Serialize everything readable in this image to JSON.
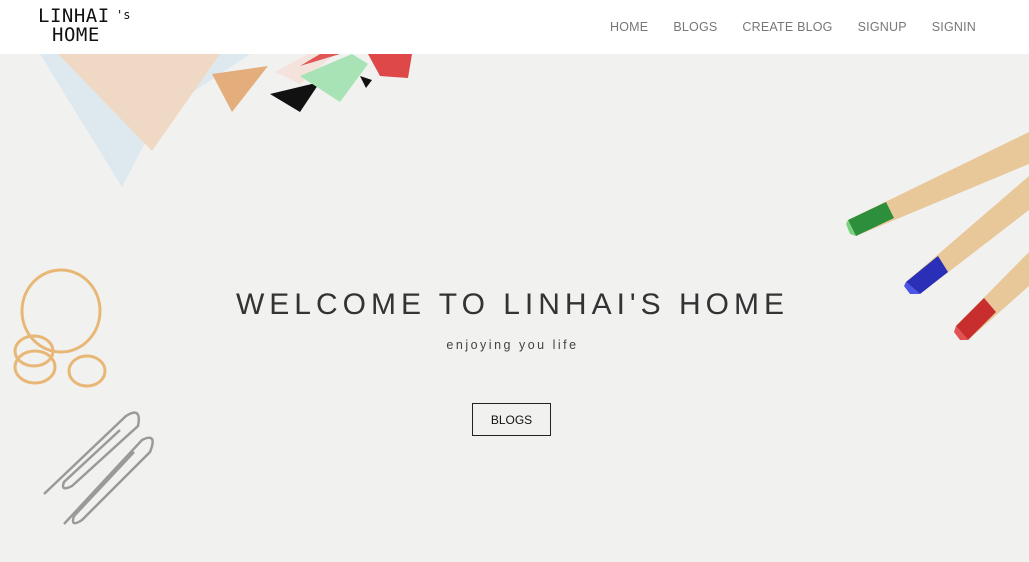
{
  "logo": {
    "line1": "LINHAI",
    "suffix": "'s",
    "line2": "HOME"
  },
  "nav": {
    "items": [
      {
        "label": "HOME"
      },
      {
        "label": "BLOGS"
      },
      {
        "label": "CREATE BLOG"
      },
      {
        "label": "SIGNUP"
      },
      {
        "label": "SIGNIN"
      }
    ]
  },
  "hero": {
    "title": "WELCOME TO LINHAI'S HOME",
    "subtitle": "enjoying you life",
    "button_label": "BLOGS"
  },
  "colors": {
    "navbar_bg": "#ffffff",
    "hero_bg": "#f1f1f0",
    "nav_text": "#777777",
    "title_text": "#333333"
  }
}
